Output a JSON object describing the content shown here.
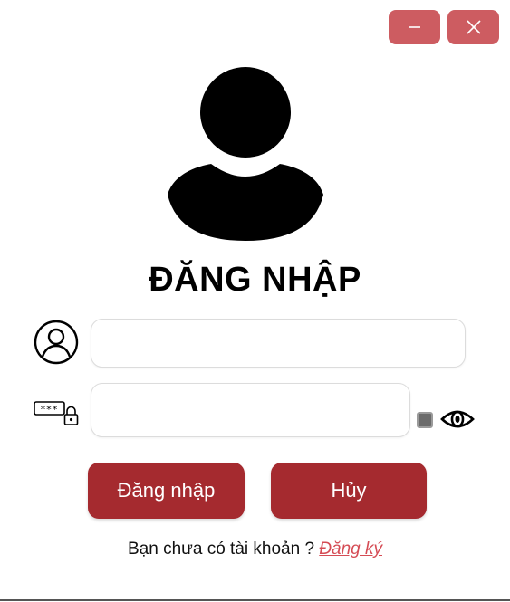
{
  "window": {
    "minimize_icon": "minimize-icon",
    "close_icon": "close-icon",
    "button_color": "#cd5c61"
  },
  "header": {
    "avatar_icon": "user-silhouette-icon",
    "title": "ĐĂNG NHẬP"
  },
  "form": {
    "username": {
      "icon": "user-circle-icon",
      "value": "",
      "placeholder": ""
    },
    "password": {
      "icon": "password-lock-icon",
      "value": "",
      "placeholder": ""
    },
    "show_password": {
      "checked": false,
      "icon": "eye-icon"
    }
  },
  "actions": {
    "login_label": "Đăng nhập",
    "cancel_label": "Hủy",
    "button_color": "#a52a2f"
  },
  "footer": {
    "prompt": "Bạn chưa có tài khoản ?",
    "register_link": "Đăng ký",
    "link_color": "#d54c55"
  }
}
